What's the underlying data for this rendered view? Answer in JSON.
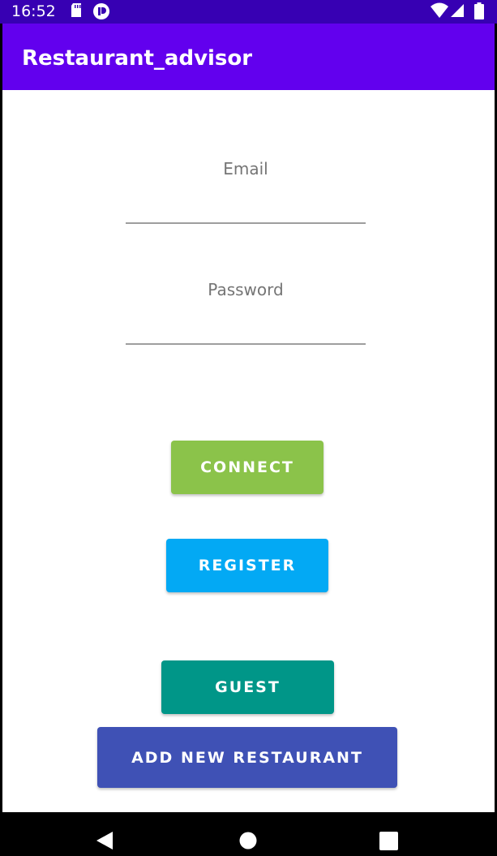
{
  "status_bar": {
    "time": "16:52"
  },
  "app_bar": {
    "title": "Restaurant_advisor"
  },
  "form": {
    "email_placeholder": "Email",
    "password_placeholder": "Password"
  },
  "buttons": {
    "connect": "CONNECT",
    "register": "REGISTER",
    "guest": "GUEST",
    "add_restaurant": "ADD NEW RESTAURANT"
  },
  "colors": {
    "status_bar": "#3700B3",
    "app_bar": "#6200EE",
    "connect": "#8BC34A",
    "register": "#03A9F4",
    "guest": "#009688",
    "add_restaurant": "#3F51B5"
  },
  "icons": {
    "status": [
      "sd-card-icon",
      "app-notification-icon",
      "wifi-icon",
      "cell-signal-icon",
      "battery-icon"
    ],
    "nav": [
      "back-icon",
      "home-icon",
      "recents-icon"
    ]
  }
}
